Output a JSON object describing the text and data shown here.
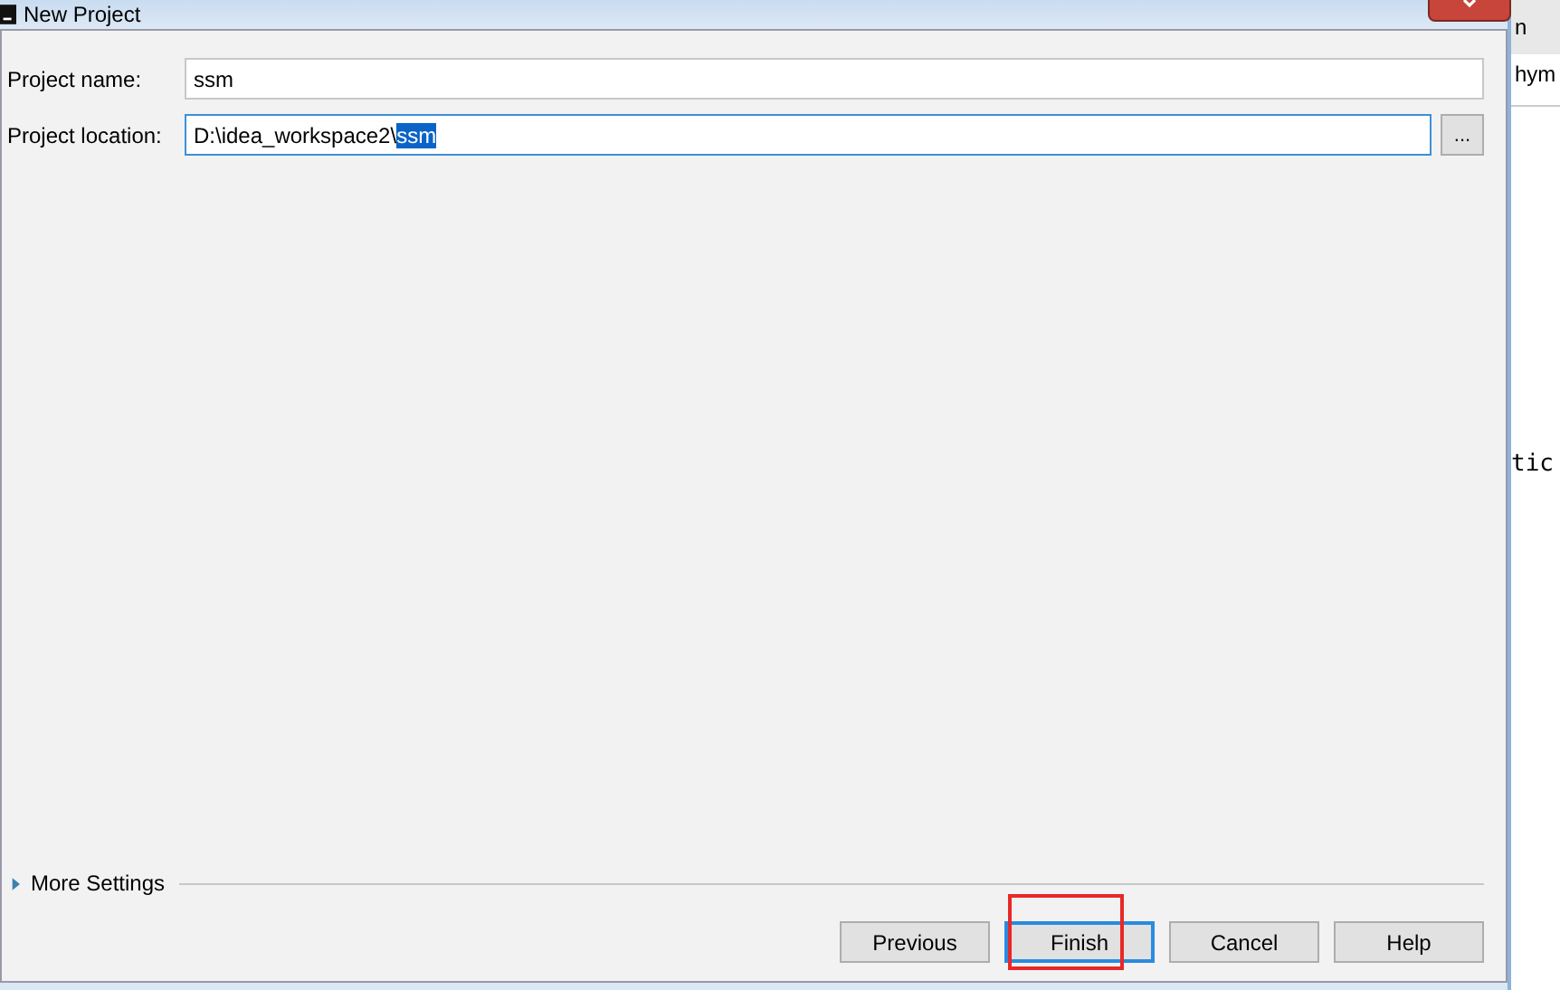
{
  "window": {
    "title": "New Project"
  },
  "fields": [
    {
      "label": "Project name:",
      "value": "ssm"
    },
    {
      "label": "Project location:",
      "value": "D:\\idea_workspace2\\",
      "selected_part": "ssm",
      "browse_label": "..."
    }
  ],
  "more_settings": {
    "label": "More Settings",
    "expanded": false
  },
  "buttons": [
    {
      "label": "Previous",
      "focused": false,
      "highlighted": false
    },
    {
      "label": "Finish",
      "focused": true,
      "highlighted": true
    },
    {
      "label": "Cancel",
      "focused": false,
      "highlighted": false
    },
    {
      "label": "Help",
      "focused": false,
      "highlighted": false
    }
  ],
  "background_window": {
    "tab_text": "n",
    "header_text": "hym",
    "code_text": "tic"
  }
}
